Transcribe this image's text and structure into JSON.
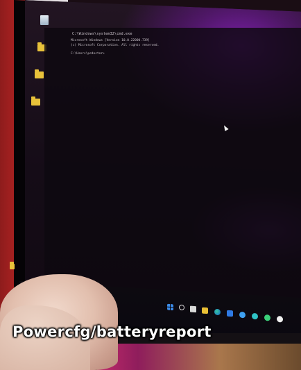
{
  "photo": {
    "description_tags": [
      "laptop",
      "command-prompt",
      "hand"
    ]
  },
  "terminal": {
    "title": "C:\\Windows\\system32\\cmd.exe",
    "lines": [
      "Microsoft Windows [Version 10.0.22000.739]",
      "(c) Microsoft Corporation. All rights reserved.",
      "C:\\Users\\pcdoctor>"
    ]
  },
  "caption": {
    "text": "Powercfg/batteryreport"
  },
  "colors": {
    "caption_text": "#ffffff",
    "wallpaper_glow": "#7a1fa8",
    "folder": "#e8c23a",
    "shirt": "#b52424"
  }
}
